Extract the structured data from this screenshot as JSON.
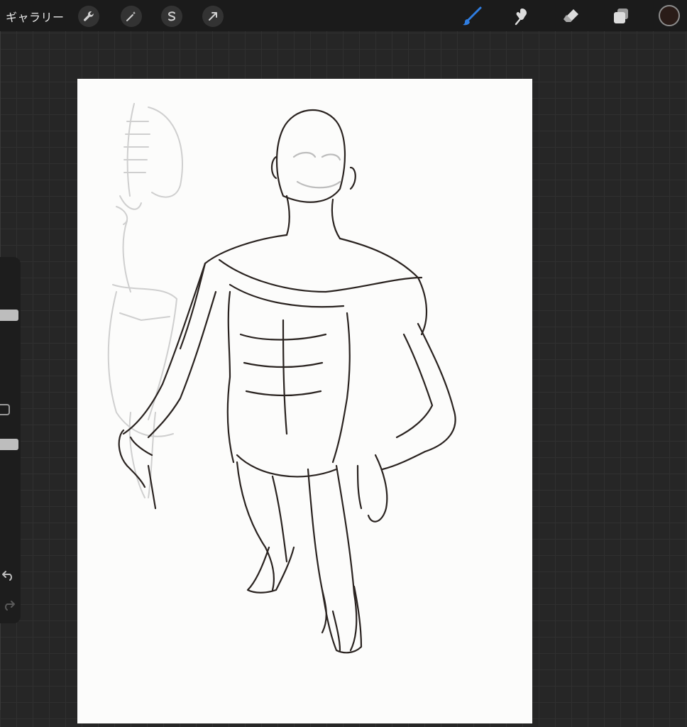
{
  "topbar": {
    "gallery_label": "ギャラリー",
    "left_tools": [
      "wrench-icon",
      "magic-wand-icon",
      "selection-icon",
      "transform-arrow-icon"
    ],
    "right_tools": [
      "brush-icon",
      "smudge-icon",
      "eraser-icon",
      "layers-icon"
    ],
    "active_tool": "brush-icon",
    "current_color": "#2a1c18"
  },
  "colors": {
    "accent": "#2f7de1",
    "background": "#262626",
    "canvas": "#fcfcfb"
  },
  "sidebar": {
    "controls": [
      "brush-size-slider",
      "modify-button",
      "opacity-slider",
      "undo-button",
      "redo-button"
    ]
  }
}
